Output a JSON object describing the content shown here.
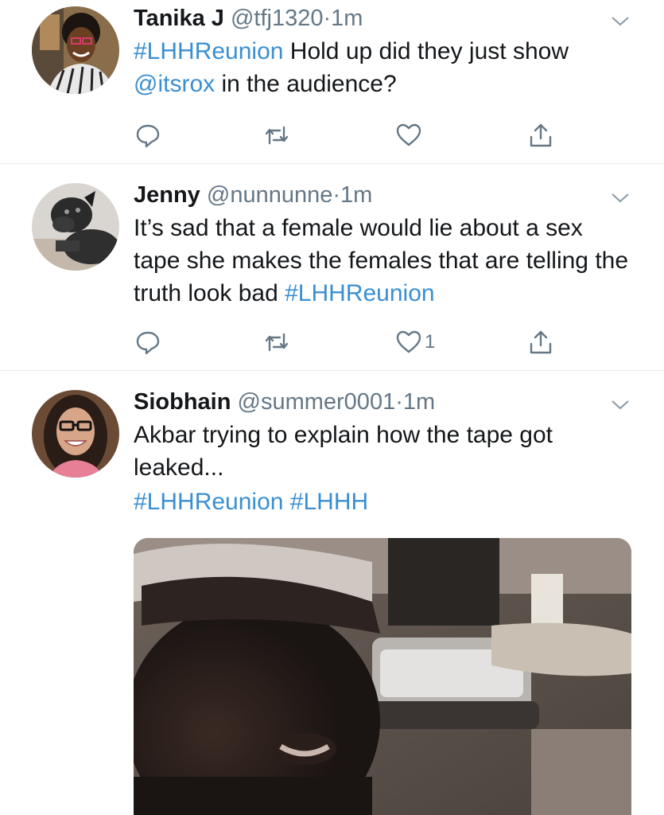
{
  "tweets": [
    {
      "name": "Tanika J",
      "handle": "@tfj1320",
      "dot": "·",
      "time": "1m",
      "text_parts": [
        "#LHHReunion",
        " Hold up did they just show ",
        "@itsrox",
        " in the audience?"
      ],
      "reply_count": "",
      "retweet_count": "",
      "like_count": ""
    },
    {
      "name": "Jenny",
      "handle": "@nunnunne",
      "dot": "·",
      "time": "1m",
      "text_parts": [
        "It’s sad that a female would lie about a sex tape she makes the females that are telling the truth look bad ",
        "#LHHReunion"
      ],
      "reply_count": "",
      "retweet_count": "",
      "like_count": "1"
    },
    {
      "name": "Siobhain",
      "handle": "@summer0001",
      "dot": "·",
      "time": "1m",
      "text_parts": [
        "Akbar trying to explain how the tape got leaked...",
        "#LHHReunion",
        " ",
        "#LHHH"
      ]
    }
  ],
  "icons": {
    "reply": "reply-icon",
    "retweet": "retweet-icon",
    "like": "heart-icon",
    "share": "share-icon",
    "menu": "chevron-down-icon"
  },
  "colors": {
    "link": "#3a8fd1",
    "secondary_text": "#657786",
    "divider": "#e6ecf0"
  }
}
